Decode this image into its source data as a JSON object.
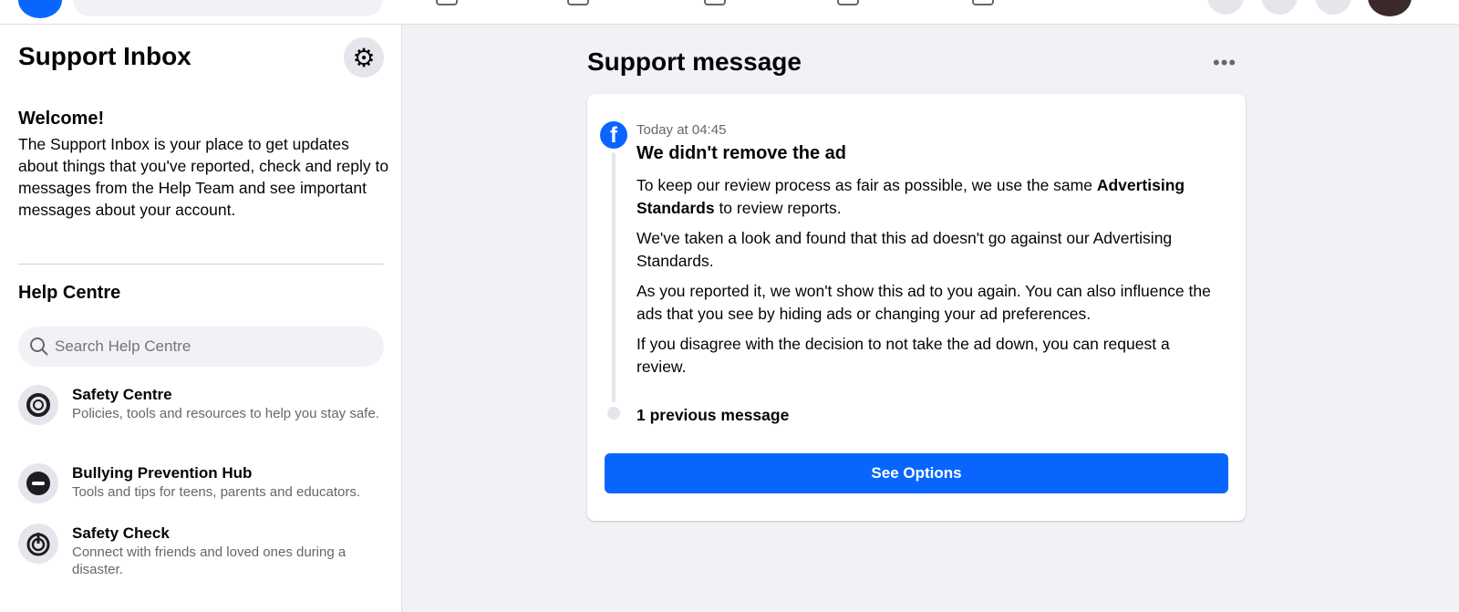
{
  "colors": {
    "accent": "#0866ff",
    "background": "#f0f2f5"
  },
  "sidebar": {
    "title": "Support Inbox",
    "settings_icon": "gear-icon",
    "welcome": {
      "heading": "Welcome!",
      "text": "The Support Inbox is your place to get updates about things that you've reported, check and reply to messages from the Help Team and see important messages about your account."
    },
    "help_centre": {
      "title": "Help Centre",
      "search_placeholder": "Search Help Centre",
      "items": [
        {
          "icon": "lifebuoy-icon",
          "name": "Safety Centre",
          "desc": "Policies, tools and resources to help you stay safe."
        },
        {
          "icon": "stop-sign-icon",
          "name": "Bullying Prevention Hub",
          "desc": "Tools and tips for teens, parents and educators."
        },
        {
          "icon": "power-icon",
          "name": "Safety Check",
          "desc": "Connect with friends and loved ones during a disaster."
        }
      ]
    }
  },
  "main": {
    "title": "Support message",
    "message": {
      "time": "Today at 04:45",
      "title": "We didn't remove the ad",
      "p1_pre": "To keep our review process as fair as possible, we use the same ",
      "p1_bold": "Advertising Standards",
      "p1_post": " to review reports.",
      "p2": "We've taken a look and found that this ad doesn't go against our Advertising Standards.",
      "p3": "As you reported it, we won't show this ad to you again. You can also influence the ads that you see by hiding ads or changing your ad preferences.",
      "p4": "If you disagree with the decision to not take the ad down, you can request a review.",
      "previous": "1 previous message",
      "button": "See Options"
    }
  }
}
